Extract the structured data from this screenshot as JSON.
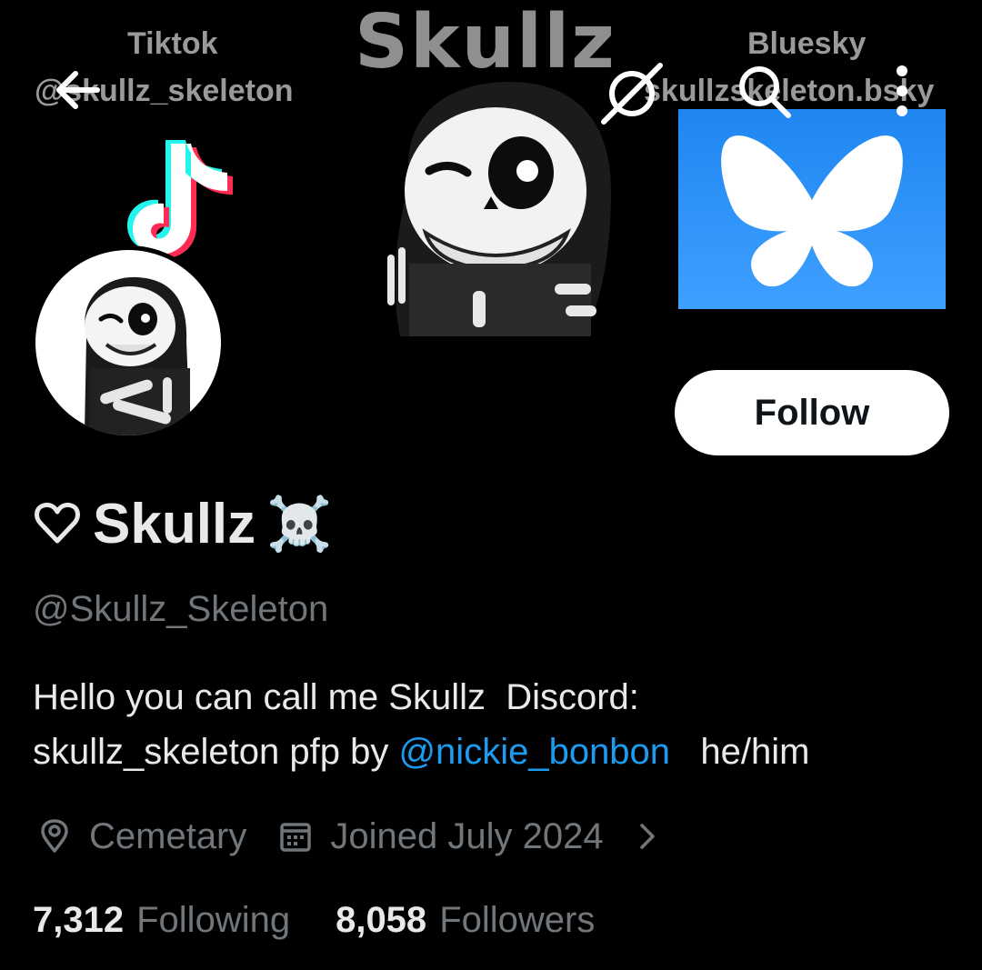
{
  "banner": {
    "left_label_title": "Tiktok",
    "left_label_handle": "@skullz_skeleton",
    "center_title": "Skullz",
    "right_label_title": "Bluesky",
    "right_label_handle": "skullzskeleton.bsky"
  },
  "topbar": {
    "back_icon": "arrow-left-icon",
    "grok_icon": "grok-icon",
    "search_icon": "search-icon",
    "more_icon": "more-vertical-icon"
  },
  "profile": {
    "name_prefix_icon": "heart-outline-icon",
    "display_name": "Skullz",
    "name_suffix_emoji": "☠️",
    "handle": "@Skullz_Skeleton",
    "follow_label": "Follow",
    "bio_line1": "Hello you can call me Skullz  Discord:",
    "bio_line2_pre": "skullz_skeleton pfp by ",
    "bio_mention": "@nickie_bonbon",
    "bio_line2_post": "   he/him",
    "location": "Cemetary",
    "joined": "Joined July 2024",
    "following_count": "7,312",
    "following_label": "Following",
    "followers_count": "8,058",
    "followers_label": "Followers"
  },
  "colors": {
    "background": "#000000",
    "primary_text": "#e7e9ea",
    "secondary_text": "#71767b",
    "link": "#1d9bf0",
    "follow_bg": "#ffffff",
    "bluesky": "#2a90f5"
  }
}
